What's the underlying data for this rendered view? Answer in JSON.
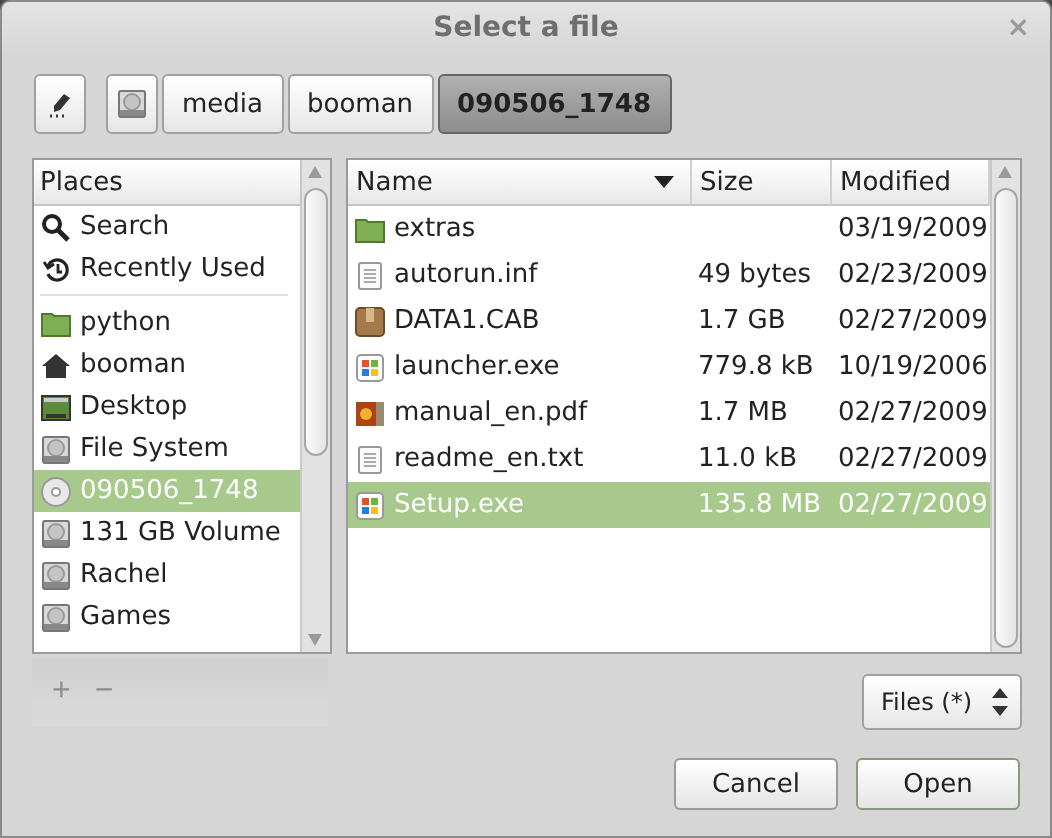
{
  "window": {
    "title": "Select a file",
    "close": "×"
  },
  "path_bar": {
    "crumbs": [
      {
        "label": "media",
        "selected": false
      },
      {
        "label": "booman",
        "selected": false
      },
      {
        "label": "090506_1748",
        "selected": true
      }
    ]
  },
  "places": {
    "header": "Places",
    "items": [
      {
        "label": "Search",
        "kind": "search",
        "selected": false
      },
      {
        "label": "Recently Used",
        "kind": "recent",
        "selected": false,
        "separator_after": true
      },
      {
        "label": "python",
        "kind": "folder",
        "selected": false
      },
      {
        "label": "booman",
        "kind": "home",
        "selected": false
      },
      {
        "label": "Desktop",
        "kind": "desktop",
        "selected": false
      },
      {
        "label": "File System",
        "kind": "drive",
        "selected": false
      },
      {
        "label": "090506_1748",
        "kind": "disc",
        "selected": true
      },
      {
        "label": "131 GB Volume",
        "kind": "drive",
        "selected": false
      },
      {
        "label": "Rachel",
        "kind": "drive",
        "selected": false
      },
      {
        "label": "Games",
        "kind": "drive",
        "selected": false
      }
    ],
    "add": {
      "label": "+",
      "disabled": true
    },
    "remove": {
      "label": "−",
      "disabled": true
    }
  },
  "files": {
    "columns": [
      "Name",
      "Size",
      "Modified"
    ],
    "rows": [
      {
        "name": "extras",
        "size": "",
        "modified": "03/19/2009",
        "kind": "folder",
        "selected": false
      },
      {
        "name": "autorun.inf",
        "size": "49 bytes",
        "modified": "02/23/2009",
        "kind": "text",
        "selected": false
      },
      {
        "name": "DATA1.CAB",
        "size": "1.7 GB",
        "modified": "02/27/2009",
        "kind": "package",
        "selected": false
      },
      {
        "name": "launcher.exe",
        "size": "779.8 kB",
        "modified": "10/19/2006",
        "kind": "exe",
        "selected": false
      },
      {
        "name": "manual_en.pdf",
        "size": "1.7 MB",
        "modified": "02/27/2009",
        "kind": "pdf",
        "selected": false
      },
      {
        "name": "readme_en.txt",
        "size": "11.0 kB",
        "modified": "02/27/2009",
        "kind": "text",
        "selected": false
      },
      {
        "name": "Setup.exe",
        "size": "135.8 MB",
        "modified": "02/27/2009",
        "kind": "exe",
        "selected": true
      }
    ]
  },
  "filter": {
    "value": "Files (*)"
  },
  "buttons": [
    {
      "label": "Cancel",
      "primary": false
    },
    {
      "label": "Open",
      "primary": true
    }
  ]
}
